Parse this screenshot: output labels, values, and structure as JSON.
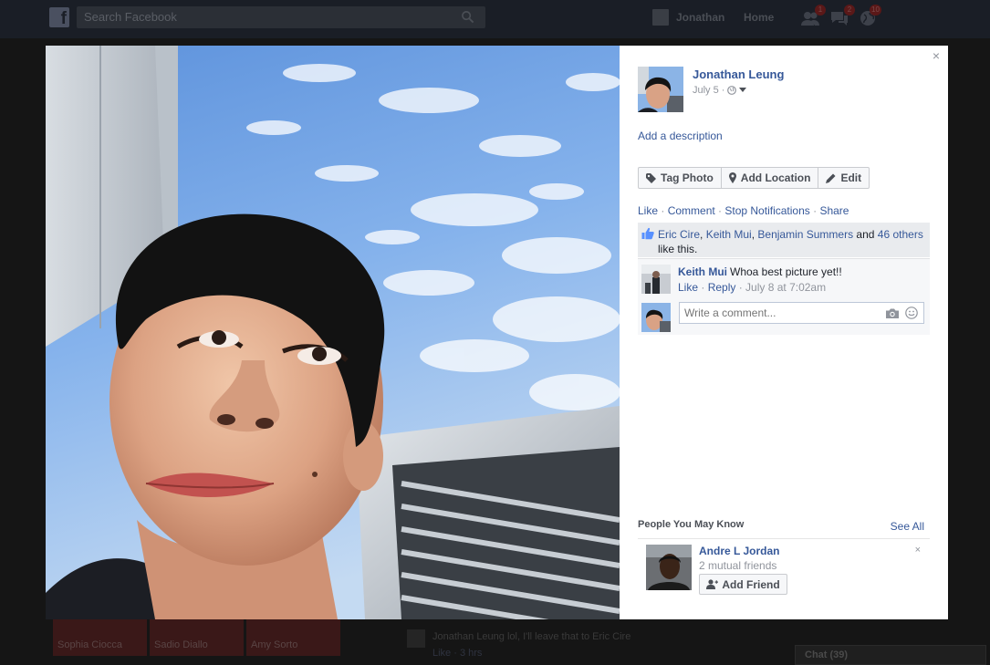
{
  "topbar": {
    "search_placeholder": "Search Facebook",
    "user_name": "Jonathan",
    "home_label": "Home",
    "friend_requests_count": "1",
    "messages_count": "2",
    "notifications_count": "10"
  },
  "background": {
    "tiles": [
      "Sophia Ciocca",
      "Sadio Diallo",
      "Amy Sorto"
    ],
    "comment_text": "Jonathan Leung lol, I'll leave that to Eric Cire",
    "comment_meta": "Like · 3 hrs",
    "chat_label": "Chat (39)"
  },
  "viewer": {
    "close_label": "×",
    "owner": {
      "name": "Jonathan Leung",
      "date": "July 5 ·"
    },
    "add_description": "Add a description",
    "actions": {
      "tag": "Tag Photo",
      "location": "Add Location",
      "edit": "Edit"
    },
    "ufi": {
      "like": "Like",
      "comment": "Comment",
      "stop_notifications": "Stop Notifications",
      "share": "Share",
      "sep": " · "
    },
    "likes": {
      "names": [
        "Eric Cire",
        "Keith Mui",
        "Benjamin Summers"
      ],
      "and_text": " and ",
      "others": "46 others",
      "suffix": "like this."
    },
    "comment": {
      "author": "Keith Mui",
      "text": "Whoa best picture yet!!",
      "like": "Like",
      "reply": "Reply",
      "time": "July 8 at 7:02am"
    },
    "composer": {
      "placeholder": "Write a comment..."
    },
    "pymk": {
      "title": "People You May Know",
      "see_all": "See All",
      "name": "Andre L Jordan",
      "mutual": "2 mutual friends",
      "add_friend": "Add Friend",
      "dismiss": "×"
    }
  },
  "colors": {
    "link": "#365899",
    "meta": "#90949c",
    "likes_bg": "#e9ebee",
    "comments_bg": "#f6f7f9"
  }
}
